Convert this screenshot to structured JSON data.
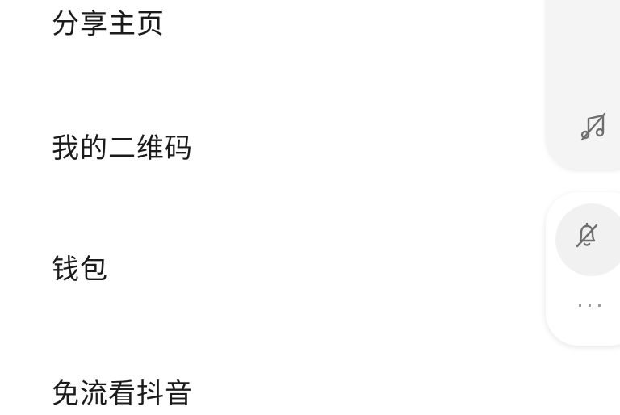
{
  "menu": {
    "items": [
      {
        "label": "分享主页"
      },
      {
        "label": "我的二维码"
      },
      {
        "label": "钱包"
      },
      {
        "label": "免流看抖音"
      }
    ]
  },
  "rail": {
    "music_icon": "music-off-icon",
    "bell_icon": "bell-off-icon",
    "more_icon": "more-dots-icon",
    "more_glyph": "···",
    "icon_color": "#6f6f6f"
  }
}
